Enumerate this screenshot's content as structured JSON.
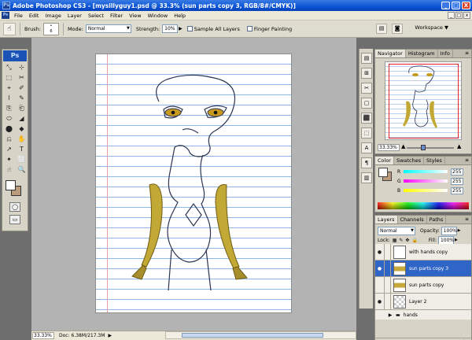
{
  "window": {
    "title": "Adobe Photoshop CS3 - [mysillyguy1.psd @ 33.3% (sun parts copy 3, RGB/8#/CMYK)]",
    "minimize": "_",
    "maximize": "□",
    "close": "X"
  },
  "menu": {
    "items": [
      "File",
      "Edit",
      "Image",
      "Layer",
      "Select",
      "Filter",
      "View",
      "Window",
      "Help"
    ],
    "mdi": [
      "_",
      "□",
      "x"
    ]
  },
  "options": {
    "brush_label": "Brush:",
    "brush_size": "6",
    "mode_label": "Mode:",
    "mode_value": "Normal",
    "strength_label": "Strength:",
    "strength_value": "10%",
    "sample_all": "Sample All Layers",
    "finger_painting": "Finger Painting",
    "workspace": "Workspace ▼"
  },
  "toolbox": {
    "logo": "Ps",
    "tools": [
      "⤡",
      "⊹",
      "⬚",
      "✂",
      "⌖",
      "✐",
      "⌇",
      "✎",
      "⎘",
      "⎗",
      "⬭",
      "◢",
      "⬤",
      "◆",
      "⎌",
      "✋",
      "↗",
      "T",
      "✦",
      "⬜",
      "☝",
      "🔍",
      "✋",
      "Q"
    ]
  },
  "status": {
    "zoom": "33.33%",
    "doc": "Doc: 6.38M/217.3M",
    "arrow": "▶"
  },
  "navigator": {
    "tabs": [
      "Navigator",
      "Histogram",
      "Info"
    ],
    "zoom": "33.33%"
  },
  "color": {
    "tabs": [
      "Color",
      "Swatches",
      "Styles"
    ],
    "channels": [
      {
        "label": "R",
        "value": "255",
        "gradient": "linear-gradient(to right, #00ffff, #ffffff)"
      },
      {
        "label": "G",
        "value": "255",
        "gradient": "linear-gradient(to right, #ff00ff, #ffffff)"
      },
      {
        "label": "B",
        "value": "255",
        "gradient": "linear-gradient(to right, #ffff00, #ffffff)"
      }
    ]
  },
  "layers": {
    "tabs": [
      "Layers",
      "Channels",
      "Paths"
    ],
    "blend": "Normal",
    "opacity_label": "Opacity:",
    "opacity": "100%",
    "lock_label": "Lock:",
    "fill_label": "Fill:",
    "fill": "100%",
    "rows": [
      {
        "name": "with hands copy",
        "visible": true,
        "thumb": "plain",
        "active": false
      },
      {
        "name": "sun parts copy 3",
        "visible": true,
        "thumb": "gold",
        "active": true
      },
      {
        "name": "sun parts copy",
        "visible": false,
        "thumb": "gold",
        "active": false
      },
      {
        "name": "Layer 2",
        "visible": true,
        "thumb": "checker",
        "active": false
      }
    ],
    "group": "hands",
    "footer_icons": [
      "∞",
      "fx",
      "◐",
      "◑",
      "▭",
      "▣",
      "🗑"
    ]
  },
  "iconstrip": [
    "▤",
    "⊞",
    "✂",
    "▢",
    "⬛",
    "⬚",
    "A",
    "¶",
    "▥"
  ]
}
